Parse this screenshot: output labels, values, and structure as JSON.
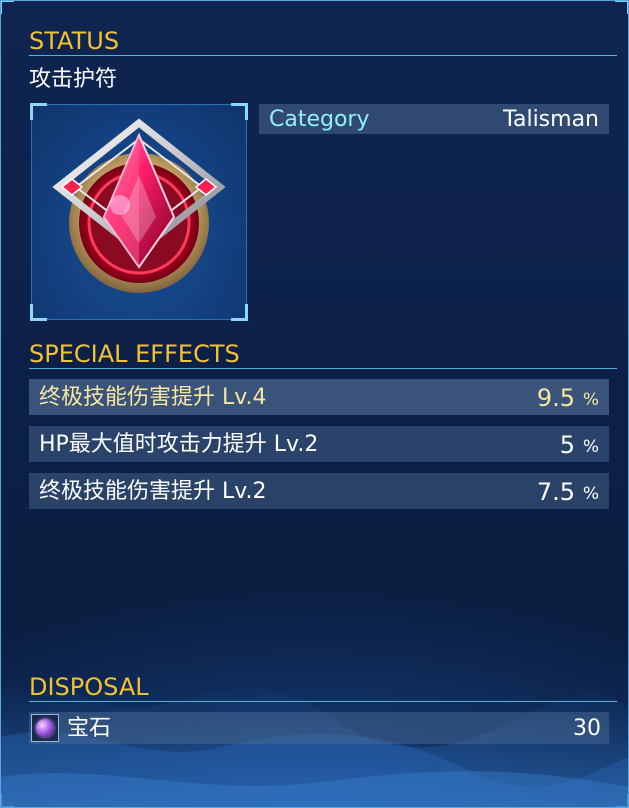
{
  "status": {
    "heading": "STATUS",
    "item_name": "攻击护符",
    "category_label": "Category",
    "category_value": "Talisman"
  },
  "special_effects": {
    "heading": "SPECIAL EFFECTS",
    "rows": [
      {
        "name": "终极技能伤害提升 Lv.4",
        "value": "9.5",
        "unit": "%"
      },
      {
        "name": "HP最大值时攻击力提升 Lv.2",
        "value": "5",
        "unit": "%"
      },
      {
        "name": "终极技能伤害提升 Lv.2",
        "value": "7.5",
        "unit": "%"
      }
    ]
  },
  "disposal": {
    "heading": "DISPOSAL",
    "item_name": "宝石",
    "quantity": "30",
    "icon": "gem-icon"
  },
  "colors": {
    "heading": "#f2c230",
    "category_label": "#8ff0f5",
    "highlight_text": "#f6e6a0",
    "divider": "#4db4e0"
  },
  "icons": {
    "item": "talisman-icon",
    "disposal": "gem-icon"
  }
}
